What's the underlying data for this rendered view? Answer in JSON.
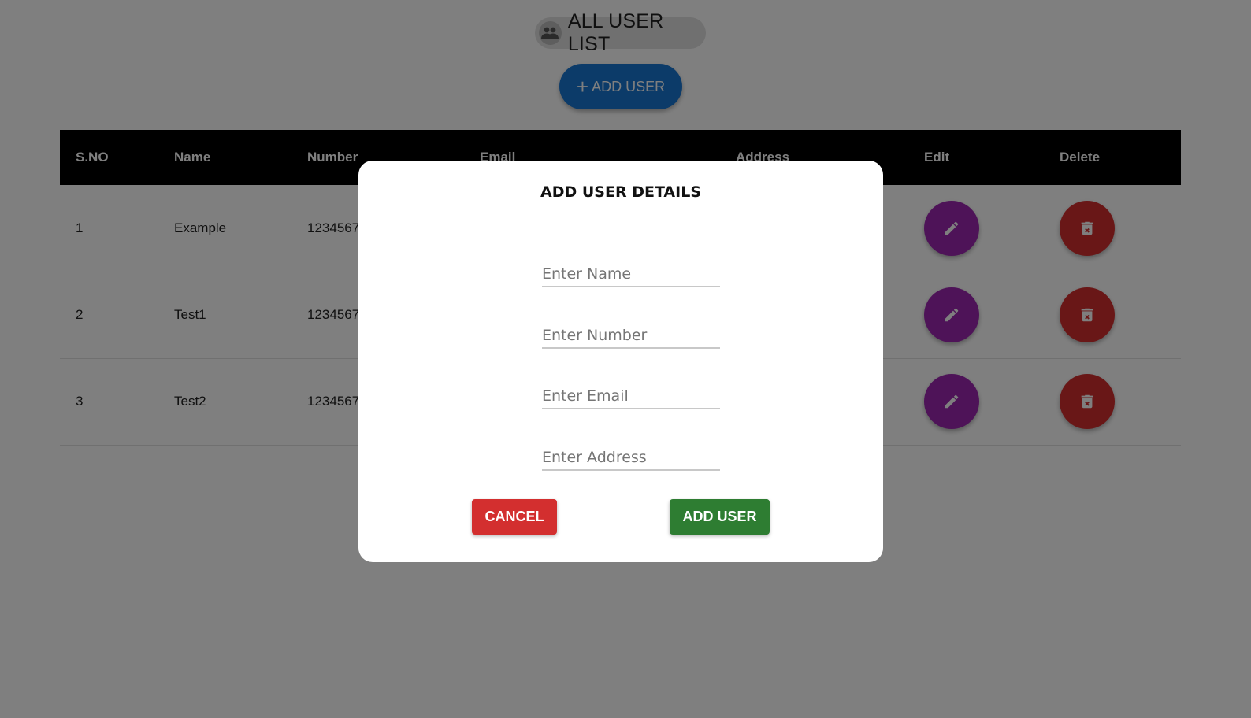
{
  "header": {
    "title": "ALL USER LIST",
    "add_user_label": "ADD USER"
  },
  "table": {
    "columns": [
      "S.NO",
      "Name",
      "Number",
      "Email",
      "Address",
      "Edit",
      "Delete"
    ],
    "rows": [
      {
        "sno": "1",
        "name": "Example",
        "number": "1234567"
      },
      {
        "sno": "2",
        "name": "Test1",
        "number": "1234567"
      },
      {
        "sno": "3",
        "name": "Test2",
        "number": "1234567"
      }
    ]
  },
  "dialog": {
    "title": "ADD USER DETAILS",
    "fields": {
      "name_placeholder": "Enter Name",
      "number_placeholder": "Enter Number",
      "email_placeholder": "Enter Email",
      "address_placeholder": "Enter Address"
    },
    "cancel_label": "CANCEL",
    "submit_label": "ADD USER"
  },
  "colors": {
    "primary": "#1976d2",
    "edit": "#9c27b0",
    "delete": "#d32f2f",
    "submit": "#2e7d32",
    "overlay": "rgba(0,0,0,0.5)"
  },
  "icons": {
    "title": "group-icon",
    "add": "plus-icon",
    "edit": "pencil-icon",
    "delete": "trash-icon"
  }
}
